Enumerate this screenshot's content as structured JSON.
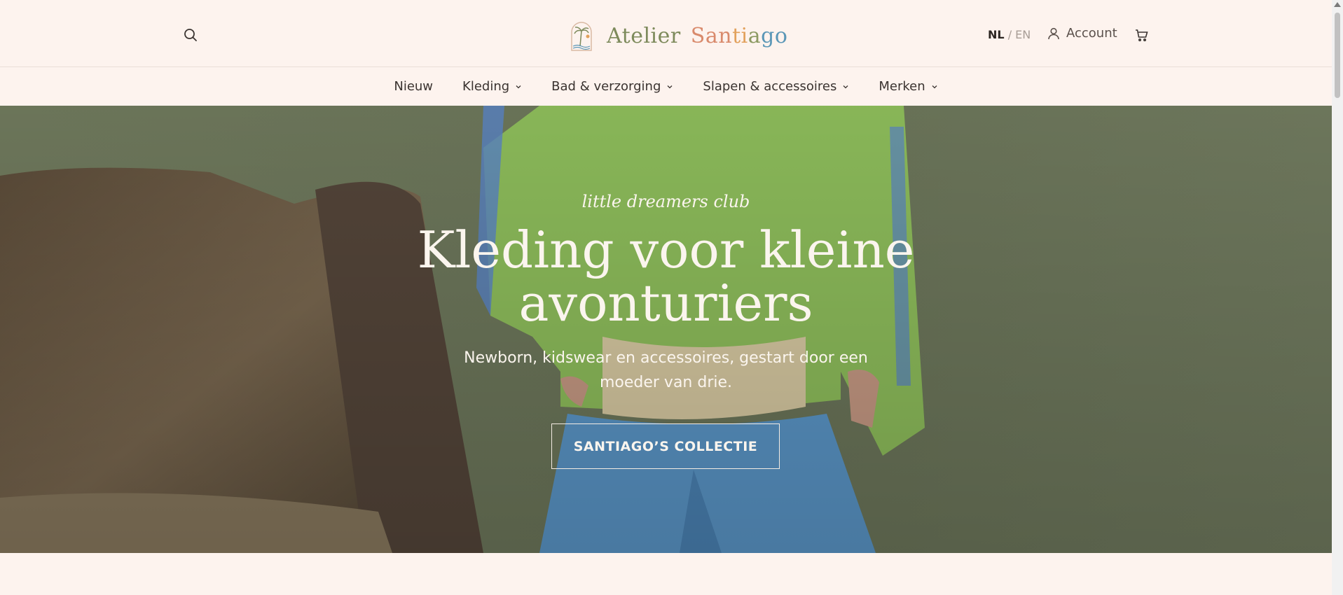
{
  "header": {
    "brand": {
      "word1": "Atelier",
      "word2_parts": [
        "S",
        "an",
        "ti",
        "a",
        "go"
      ]
    },
    "lang": {
      "active": "NL",
      "separator": "/",
      "inactive": "EN"
    },
    "account_label": "Account",
    "icons": {
      "search": "search-icon",
      "account": "user-icon",
      "cart": "cart-icon",
      "logo": "palm-tree-icon"
    }
  },
  "nav": {
    "items": [
      {
        "label": "Nieuw",
        "has_dropdown": false
      },
      {
        "label": "Kleding",
        "has_dropdown": true
      },
      {
        "label": "Bad & verzorging",
        "has_dropdown": true
      },
      {
        "label": "Slapen & accessoires",
        "has_dropdown": true
      },
      {
        "label": "Merken",
        "has_dropdown": true
      }
    ]
  },
  "hero": {
    "eyebrow": "little dreamers club",
    "headline": "Kleding voor kleine avonturiers",
    "subtitle": "Newborn, kidswear en accessoires, gestart door een moeder van drie.",
    "cta_label": "SANTIAGO’S COLLECTIE"
  },
  "colors": {
    "page_bg": "#fdf3ee",
    "hero_bg": "#6f7a5c",
    "sweater": "#8fbf5c",
    "pants": "#5b97c9",
    "sofa": "#6b5a44"
  }
}
